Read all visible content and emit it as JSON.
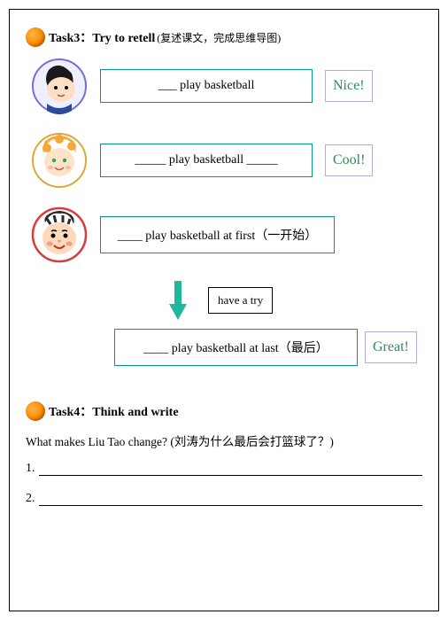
{
  "task3": {
    "title": "Task3：Try to retell",
    "subtitle": "(复述课文，完成思维导图)",
    "rows": [
      {
        "text": "___ play basketball",
        "badge": "Nice!"
      },
      {
        "text": "_____ play basketball _____",
        "badge": "Cool!"
      },
      {
        "text": "____ play basketball at first（一开始）"
      }
    ],
    "try_text": "have a try",
    "last_text": "____ play basketball at last（最后）",
    "last_badge": "Great!"
  },
  "task4": {
    "title": "Task4：Think and write",
    "question": "What makes Liu Tao change? (刘涛为什么最后会打篮球了？)",
    "lines": [
      "1.",
      "2."
    ]
  }
}
